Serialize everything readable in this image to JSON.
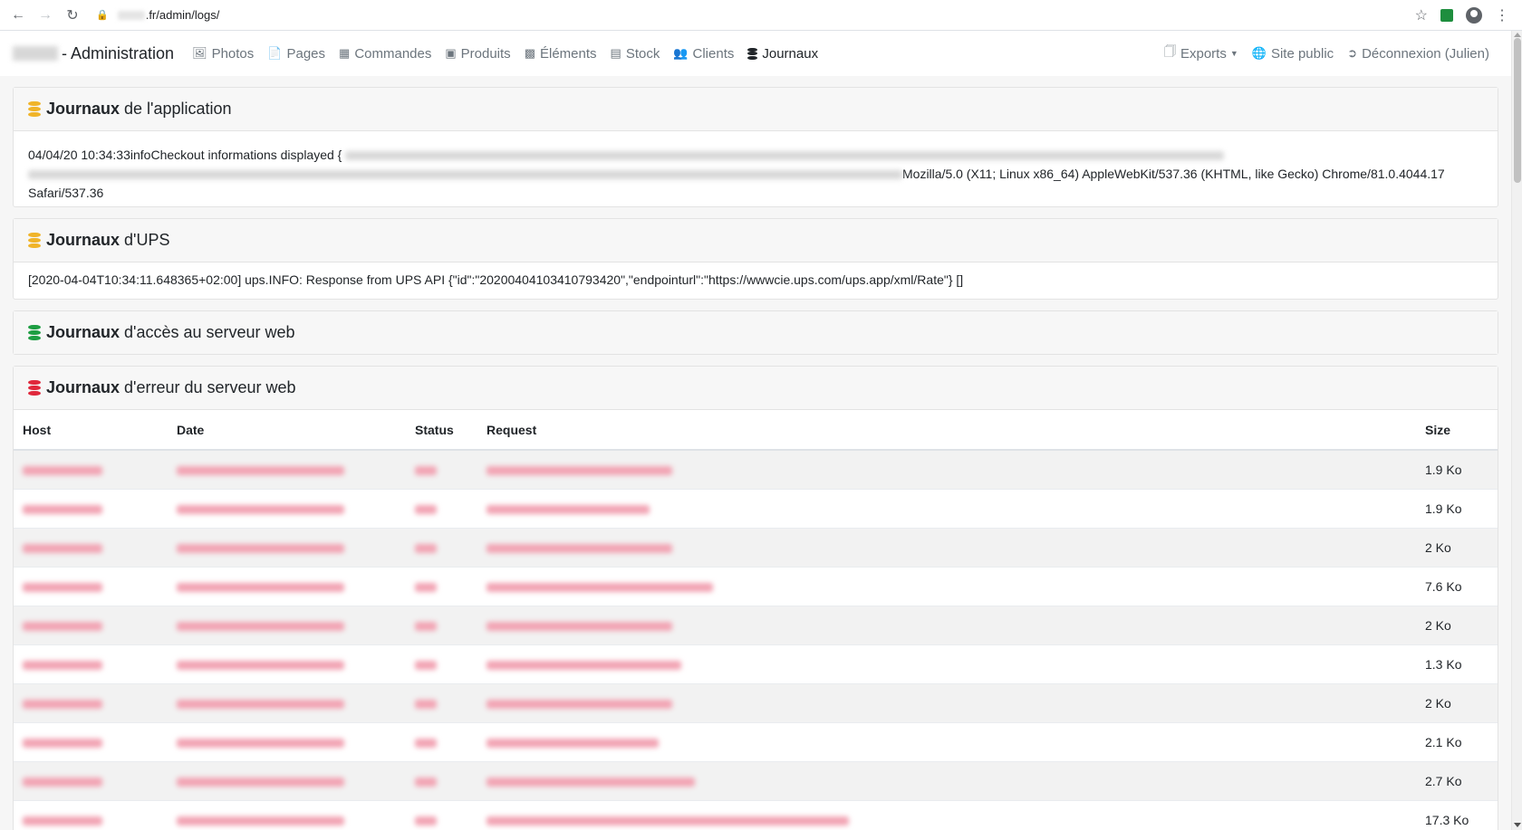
{
  "browser": {
    "url": ".fr/admin/logs/",
    "icons": [
      "back-icon",
      "forward-icon",
      "reload-icon",
      "lock-icon",
      "star-icon",
      "extension-icon",
      "profile-icon",
      "menu-icon"
    ]
  },
  "navbar": {
    "brand_suffix": "- Administration",
    "items": [
      {
        "label": "Photos",
        "icon": "image-icon"
      },
      {
        "label": "Pages",
        "icon": "file-icon"
      },
      {
        "label": "Commandes",
        "icon": "cash-register-icon"
      },
      {
        "label": "Produits",
        "icon": "boxes-icon"
      },
      {
        "label": "Éléments",
        "icon": "puzzle-icon"
      },
      {
        "label": "Stock",
        "icon": "sitemap-icon"
      },
      {
        "label": "Clients",
        "icon": "users-icon"
      },
      {
        "label": "Journaux",
        "icon": "database-icon",
        "active": true
      }
    ],
    "right": [
      {
        "label": "Exports",
        "icon": "file-excel-icon"
      },
      {
        "label": "Site public",
        "icon": "globe-icon"
      },
      {
        "label": "Déconnexion (Julien)",
        "icon": "sign-out-icon"
      }
    ]
  },
  "cards": {
    "app": {
      "title_bold": "Journaux",
      "title_rest": "de l'application",
      "line_start": "04/04/20 10:34:33infoCheckout informations displayed {",
      "line_end": "Mozilla/5.0 (X11; Linux x86_64) AppleWebKit/537.36 (KHTML, like Gecko) Chrome/81.0.4044.17",
      "line_tail": "Safari/537.36"
    },
    "ups": {
      "title_bold": "Journaux",
      "title_rest": "d'UPS",
      "line": "[2020-04-04T10:34:11.648365+02:00] ups.INFO: Response from UPS API {\"id\":\"20200404103410793420\",\"endpointurl\":\"https://wwwcie.ups.com/ups.app/xml/Rate\"} []"
    },
    "access": {
      "title_bold": "Journaux",
      "title_rest": "d'accès au serveur web"
    },
    "error": {
      "title_bold": "Journaux",
      "title_rest": "d'erreur du serveur web",
      "columns": {
        "host": "Host",
        "date": "Date",
        "status": "Status",
        "request": "Request",
        "size": "Size"
      },
      "rows": [
        {
          "size": "1.9 Ko"
        },
        {
          "size": "1.9 Ko"
        },
        {
          "size": "2 Ko"
        },
        {
          "size": "7.6 Ko"
        },
        {
          "size": "2 Ko"
        },
        {
          "size": "1.3 Ko"
        },
        {
          "size": "2 Ko"
        },
        {
          "size": "2.1 Ko"
        },
        {
          "size": "2.7 Ko"
        },
        {
          "size": "17.3 Ko"
        }
      ]
    }
  },
  "colors": {
    "yellow_db": "#f0b429",
    "green_db": "#1e9e43",
    "red_db": "#e0283c",
    "blur_pink": "#f2a3b3"
  }
}
